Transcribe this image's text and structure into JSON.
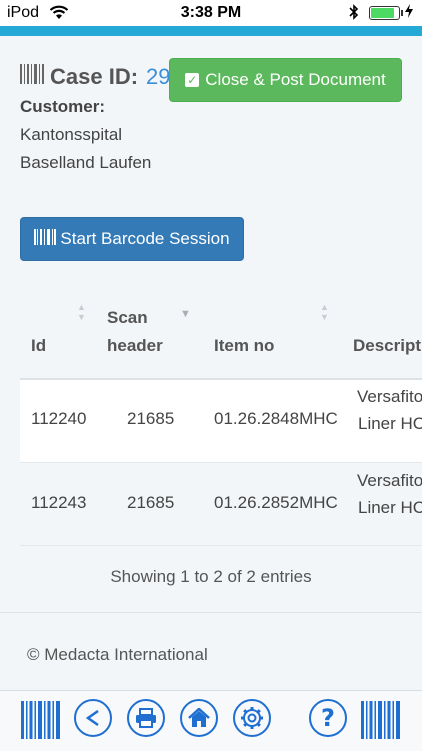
{
  "status": {
    "carrier": "iPod",
    "time": "3:38 PM"
  },
  "case": {
    "label": "Case ID:",
    "id": "29"
  },
  "customer": {
    "label": "Customer:",
    "lines": [
      "Kantonsspital",
      "Baselland Laufen"
    ]
  },
  "buttons": {
    "close_post": "Close & Post Document",
    "start_barcode": "Start Barcode Session"
  },
  "table": {
    "headers": {
      "id": "Id",
      "scan_header_1": "Scan",
      "scan_header_2": "header",
      "item_no": "Item no",
      "description": "Descript"
    },
    "rows": [
      {
        "id": "112240",
        "scan_header": "21685",
        "item_no": "01.26.2848MHC",
        "desc1": "Versafito",
        "desc2": "Liner HC"
      },
      {
        "id": "112243",
        "scan_header": "21685",
        "item_no": "01.26.2852MHC",
        "desc1": "Versafito",
        "desc2": "Liner HC"
      }
    ],
    "info": "Showing 1 to 2 of 2 entries"
  },
  "footer": {
    "copyright": "© Medacta International"
  },
  "toolbar": {
    "icons": [
      "barcode-scan-icon",
      "back-icon",
      "print-icon",
      "home-icon",
      "settings-icon",
      "help-icon",
      "barcode-scan-icon"
    ]
  },
  "colors": {
    "accent": "#25a9d6",
    "success": "#5cb85c",
    "primary": "#337ab7",
    "toolbar_icon": "#1f6fd1"
  },
  "battery_level": 0.9
}
